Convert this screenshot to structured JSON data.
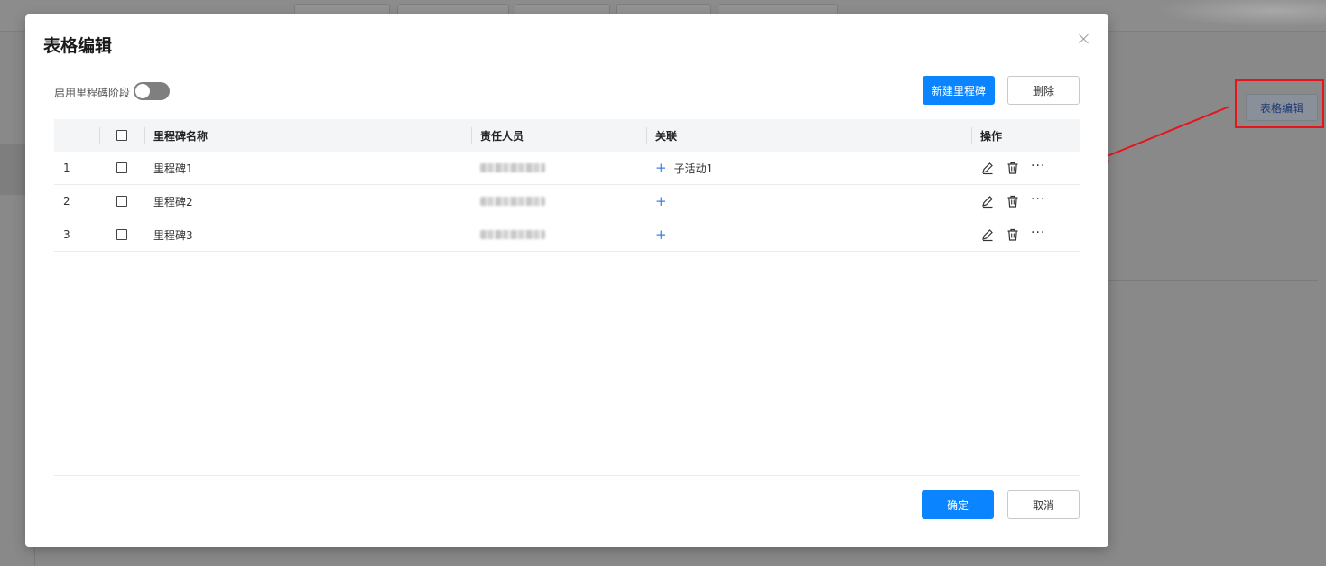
{
  "background": {
    "tabs": [
      "",
      "",
      "",
      "",
      ""
    ],
    "table_edit_label": "表格编辑",
    "annotation_color": "#e6141b"
  },
  "modal": {
    "title": "表格编辑",
    "toggle": {
      "label": "启用里程碑阶段",
      "on": false
    },
    "new_milestone_label": "新建里程碑",
    "delete_label": "删除",
    "columns": {
      "name": "里程碑名称",
      "owner": "责任人员",
      "link": "关联",
      "ops": "操作"
    },
    "rows": [
      {
        "index": "1",
        "name": "里程碑1",
        "owner": "",
        "link": "子活动1"
      },
      {
        "index": "2",
        "name": "里程碑2",
        "owner": "",
        "link": ""
      },
      {
        "index": "3",
        "name": "里程碑3",
        "owner": "",
        "link": ""
      }
    ],
    "ok_label": "确定",
    "cancel_label": "取消"
  },
  "colors": {
    "primary": "#0a84ff",
    "accent_plus": "#3e7ee8",
    "annotation": "#e6141b"
  }
}
